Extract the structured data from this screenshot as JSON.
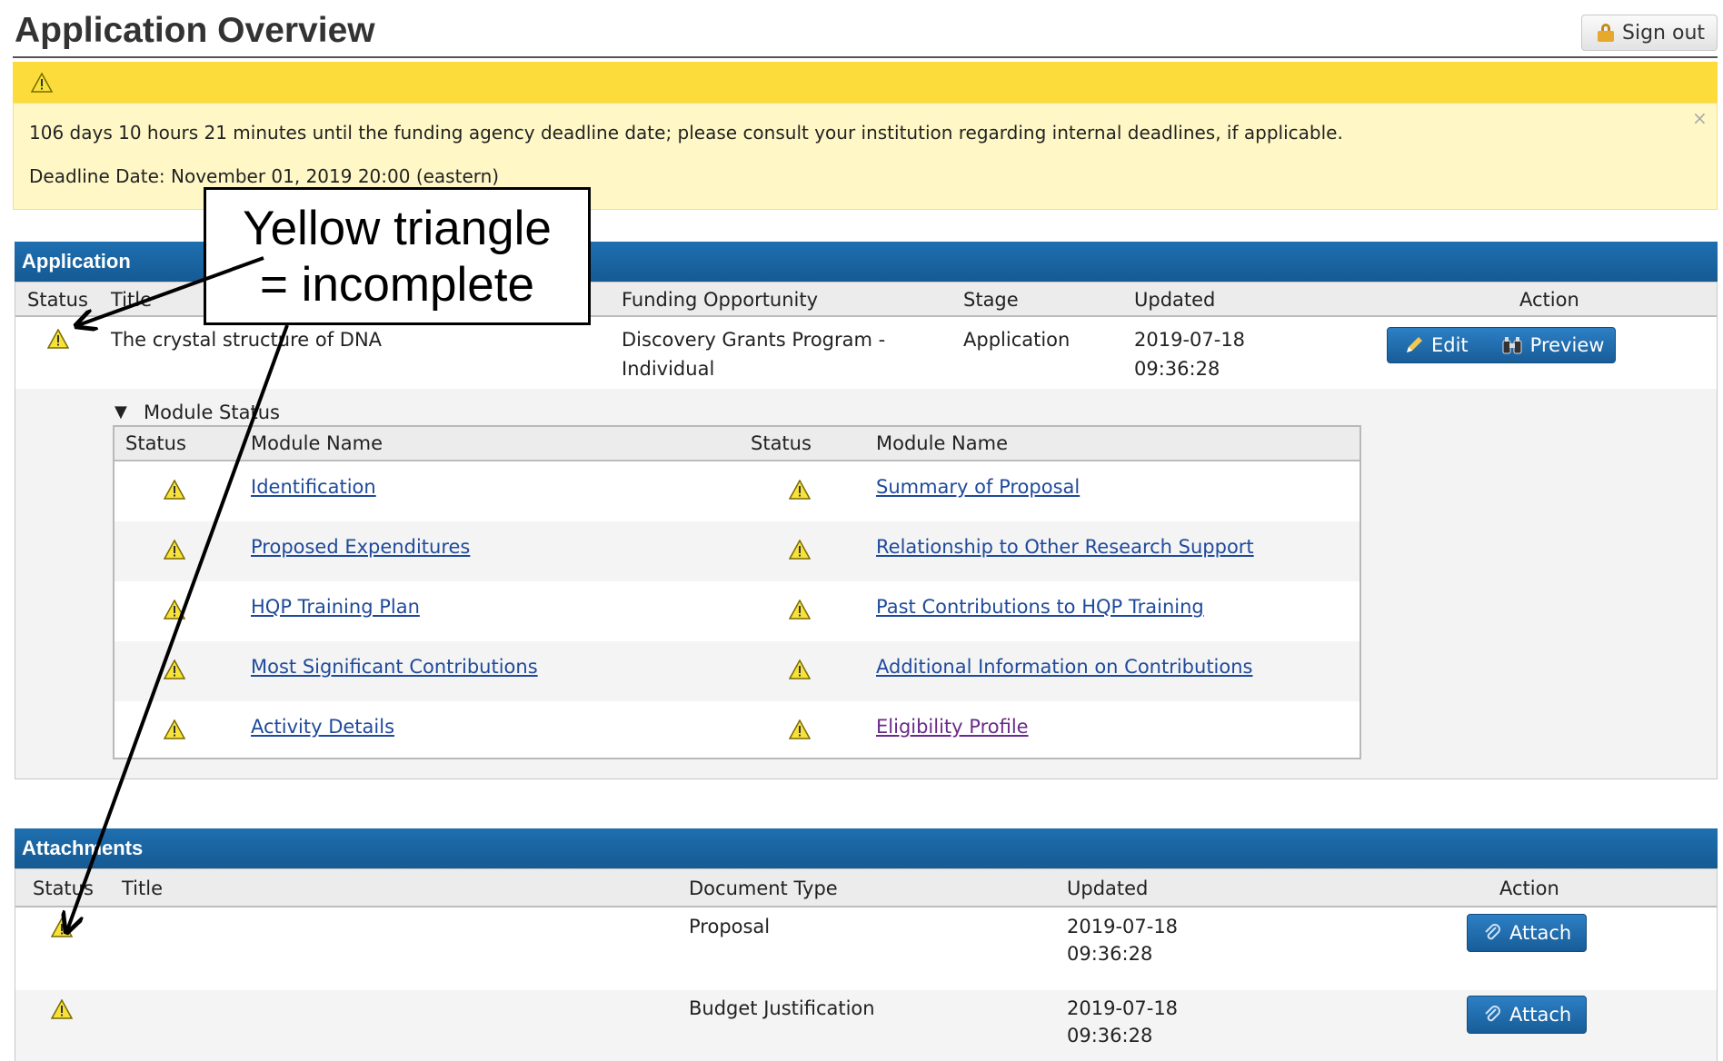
{
  "header": {
    "title": "Application Overview",
    "sign_out_label": "Sign out"
  },
  "alert": {
    "countdown_text": "106 days 10 hours 21 minutes until the funding agency deadline date; please consult your institution regarding internal deadlines, if applicable.",
    "deadline_text": "Deadline Date: November 01, 2019 20:00 (eastern)",
    "close_glyph": "×"
  },
  "application": {
    "panel_title": "Application",
    "columns": {
      "status": "Status",
      "title": "Title",
      "funding": "Funding Opportunity",
      "stage": "Stage",
      "updated": "Updated",
      "action": "Action"
    },
    "row": {
      "title": "The crystal structure of DNA",
      "funding_line1": "Discovery Grants Program -",
      "funding_line2": "Individual",
      "stage": "Application",
      "updated_date": "2019-07-18",
      "updated_time": "09:36:28"
    },
    "edit_label": "Edit",
    "preview_label": "Preview"
  },
  "modules": {
    "toggle_glyph": "▼",
    "label": "Module Status",
    "columns": {
      "status_left": "Status",
      "name_left": "Module Name",
      "status_right": "Status",
      "name_right": "Module Name"
    },
    "left": [
      "Identification",
      "Proposed Expenditures",
      "HQP Training Plan",
      "Most Significant Contributions",
      "Activity Details"
    ],
    "right": [
      "Summary of Proposal",
      "Relationship to Other Research Support",
      "Past Contributions to HQP Training",
      "Additional Information on Contributions",
      "Eligibility Profile"
    ]
  },
  "attachments": {
    "panel_title": "Attachments",
    "columns": {
      "status": "Status",
      "title": "Title",
      "doc_type": "Document Type",
      "updated": "Updated",
      "action": "Action"
    },
    "rows": [
      {
        "doc_type": "Proposal",
        "updated_date": "2019-07-18",
        "updated_time": "09:36:28"
      },
      {
        "doc_type": "Budget Justification",
        "updated_date": "2019-07-18",
        "updated_time": "09:36:28"
      }
    ],
    "attach_label": "Attach"
  },
  "annotation": {
    "line1": "Yellow triangle",
    "line2": "= incomplete"
  },
  "colors": {
    "panel_header": "#1f6fb0",
    "warning_yellow": "#f5d90a",
    "alert_bar": "#fbdc3a",
    "link": "#1f4a9a"
  },
  "icons": {
    "warning": "warning-triangle-icon",
    "lock": "lock-icon",
    "pencil": "pencil-icon",
    "binoculars": "binoculars-icon",
    "paperclip": "paperclip-icon"
  }
}
